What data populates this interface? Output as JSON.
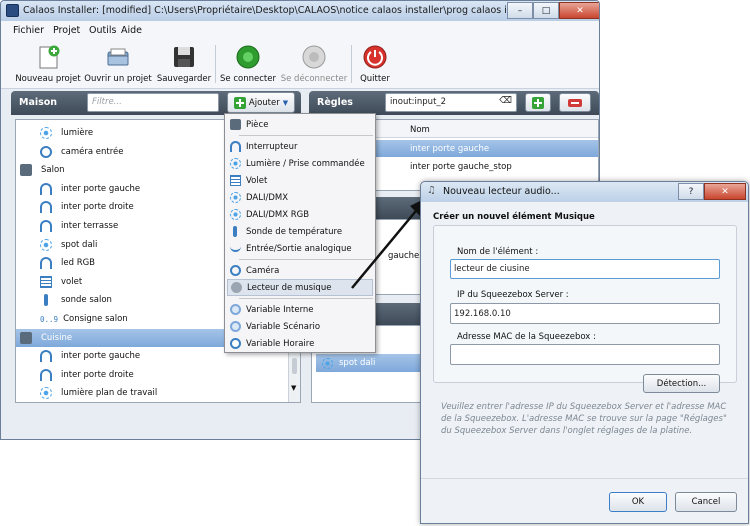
{
  "main_window": {
    "title": "Calaos Installer: [modified] C:\\Users\\Propriétaire\\Desktop\\CALAOS\\notice calaos installer\\prog calaos installater",
    "controls": {
      "minimize": "–",
      "maximize": "□",
      "close": "✕"
    }
  },
  "menu": [
    "Fichier",
    "Projet",
    "Outils",
    "Aide"
  ],
  "toolbar": {
    "new_project": "Nouveau projet",
    "open_project": "Ouvrir un projet",
    "save": "Sauvegarder",
    "connect": "Se connecter",
    "disconnect": "Se déconnecter",
    "quit": "Quitter"
  },
  "maison": {
    "title": "Maison",
    "filter_placeholder": "Filtre...",
    "add_button": "Ajouter",
    "tree": [
      {
        "label": "lumière",
        "icon": "sun-icon",
        "indent": 1
      },
      {
        "label": "caméra entrée",
        "icon": "camera-icon",
        "indent": 1
      },
      {
        "label": "Salon",
        "icon": "room-icon",
        "indent": 0
      },
      {
        "label": "inter porte gauche",
        "icon": "door-icon",
        "indent": 1
      },
      {
        "label": "inter porte droite",
        "icon": "door-icon",
        "indent": 1
      },
      {
        "label": "inter terrasse",
        "icon": "door-icon",
        "indent": 1
      },
      {
        "label": "spot dali",
        "icon": "sun-icon",
        "indent": 1
      },
      {
        "label": "led RGB",
        "icon": "door-icon",
        "indent": 1
      },
      {
        "label": "volet",
        "icon": "shutter-icon",
        "indent": 1
      },
      {
        "label": "sonde salon",
        "icon": "thermometer-icon",
        "indent": 1
      },
      {
        "label": "Consigne salon",
        "icon": "numeric-icon",
        "indent": 1
      },
      {
        "label": "Cuisine",
        "icon": "room-icon",
        "indent": 0,
        "selected": true
      },
      {
        "label": "inter porte gauche",
        "icon": "door-icon",
        "indent": 1
      },
      {
        "label": "inter porte droite",
        "icon": "door-icon",
        "indent": 1
      },
      {
        "label": "lumière plan de travail",
        "icon": "sun-icon",
        "indent": 1
      }
    ],
    "numeric_icon_text": "0..9"
  },
  "dropdown": [
    {
      "label": "Pièce",
      "icon": "room-icon"
    },
    {
      "sep": true
    },
    {
      "label": "Interrupteur",
      "icon": "switch-icon"
    },
    {
      "label": "Lumière / Prise commandée",
      "icon": "sun-icon"
    },
    {
      "label": "Volet",
      "icon": "shutter-icon"
    },
    {
      "label": "DALI/DMX",
      "icon": "sun-icon"
    },
    {
      "label": "DALI/DMX RGB",
      "icon": "sun-icon"
    },
    {
      "label": "Sonde de température",
      "icon": "thermometer-icon"
    },
    {
      "label": "Entrée/Sortie analogique",
      "icon": "wave-icon"
    },
    {
      "sep": true
    },
    {
      "label": "Caméra",
      "icon": "camera-icon"
    },
    {
      "label": "Lecteur de musique",
      "icon": "music-icon",
      "hover": true
    },
    {
      "sep": true
    },
    {
      "label": "Variable Interne",
      "icon": "variable-icon"
    },
    {
      "label": "Variable Scénario",
      "icon": "variable-icon"
    },
    {
      "label": "Variable Horaire",
      "icon": "clock-icon"
    }
  ],
  "regles": {
    "title": "Règles",
    "search_value": "inout:input_2",
    "column_name": "Nom",
    "rows": [
      {
        "label": "inter porte gauche",
        "selected": true
      },
      {
        "label": "inter porte gauche_stop",
        "selected": false
      }
    ],
    "fragment_label": "gauche",
    "bottom_item": "spot dali"
  },
  "dialog": {
    "title": "Nouveau lecteur audio...",
    "controls": {
      "help": "?",
      "close": "✕"
    },
    "heading": "Créer un nouvel élément Musique",
    "name_label": "Nom de l'élément :",
    "name_value": "lecteur de ciusine",
    "ip_label": "IP du Squeezebox Server :",
    "ip_value": "192.168.0.10",
    "mac_label": "Adresse MAC de la Squeezebox :",
    "mac_value": "",
    "detect_button": "Détection...",
    "help_text": "Veuillez entrer l'adresse IP du Squeezebox Server et l'adresse MAC de la Squeezebox. L'adresse MAC se trouve sur la page \"Réglages\" du Squeezebox Server dans l'onglet réglages de la platine.",
    "ok_button": "OK",
    "cancel_button": "Cancel"
  }
}
